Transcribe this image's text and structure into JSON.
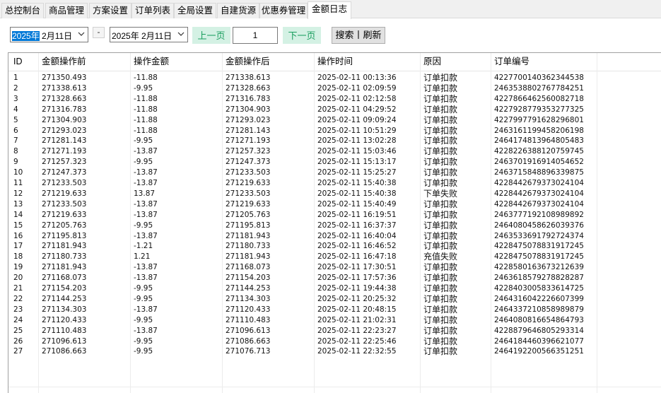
{
  "tabs": [
    {
      "label": "总控制台",
      "active": false
    },
    {
      "label": "商品管理",
      "active": false
    },
    {
      "label": "方案设置",
      "active": false
    },
    {
      "label": "订单列表",
      "active": false
    },
    {
      "label": "全局设置",
      "active": false
    },
    {
      "label": "自建货源",
      "active": false
    },
    {
      "label": "优惠券管理",
      "active": false
    },
    {
      "label": "金额日志",
      "active": true
    }
  ],
  "toolbar": {
    "start_date_year": "2025年",
    "start_date_rest": " 2月11日",
    "end_date": "2025年  2月11日",
    "separator": "-",
    "prev_label": "上一页",
    "page_value": "1",
    "next_label": "下一页",
    "search_label": "搜索丨刷新"
  },
  "colors": {
    "accent_green_bg": "#d4f1e4",
    "accent_green_text": "#1a9e5f",
    "selection_blue": "#0078d7"
  },
  "table": {
    "columns": [
      "ID",
      "金额操作前",
      "操作金额",
      "金额操作后",
      "操作时间",
      "原因",
      "订单编号"
    ],
    "rows": [
      [
        "1",
        "271350.493",
        "-11.88",
        "271338.613",
        "2025-02-11 00:13:36",
        "订单扣款",
        "4227700140362344538"
      ],
      [
        "2",
        "271338.613",
        "-9.95",
        "271328.663",
        "2025-02-11 02:09:59",
        "订单扣款",
        "2463538802767784251"
      ],
      [
        "3",
        "271328.663",
        "-11.88",
        "271316.783",
        "2025-02-11 02:12:58",
        "订单扣款",
        "4227866462560082718"
      ],
      [
        "4",
        "271316.783",
        "-11.88",
        "271304.903",
        "2025-02-11 04:29:52",
        "订单扣款",
        "4227928779353277325"
      ],
      [
        "5",
        "271304.903",
        "-11.88",
        "271293.023",
        "2025-02-11 09:09:24",
        "订单扣款",
        "4227997791628296801"
      ],
      [
        "6",
        "271293.023",
        "-11.88",
        "271281.143",
        "2025-02-11 10:51:29",
        "订单扣款",
        "2463161199458206198"
      ],
      [
        "7",
        "271281.143",
        "-9.95",
        "271271.193",
        "2025-02-11 13:02:28",
        "订单扣款",
        "2464174813964805483"
      ],
      [
        "8",
        "271271.193",
        "-13.87",
        "271257.323",
        "2025-02-11 15:03:46",
        "订单扣款",
        "4228226388120759745"
      ],
      [
        "9",
        "271257.323",
        "-9.95",
        "271247.373",
        "2025-02-11 15:13:17",
        "订单扣款",
        "2463701916914054652"
      ],
      [
        "10",
        "271247.373",
        "-13.87",
        "271233.503",
        "2025-02-11 15:25:27",
        "订单扣款",
        "2463715848896339875"
      ],
      [
        "11",
        "271233.503",
        "-13.87",
        "271219.633",
        "2025-02-11 15:40:38",
        "订单扣款",
        "4228442679373024104"
      ],
      [
        "12",
        "271219.633",
        "13.87",
        "271233.503",
        "2025-02-11 15:40:38",
        "下单失败",
        "4228442679373024104"
      ],
      [
        "13",
        "271233.503",
        "-13.87",
        "271219.633",
        "2025-02-11 15:40:49",
        "订单扣款",
        "4228442679373024104"
      ],
      [
        "14",
        "271219.633",
        "-13.87",
        "271205.763",
        "2025-02-11 16:19:51",
        "订单扣款",
        "2463777192108989892"
      ],
      [
        "15",
        "271205.763",
        "-9.95",
        "271195.813",
        "2025-02-11 16:37:37",
        "订单扣款",
        "2464080458626039376"
      ],
      [
        "16",
        "271195.813",
        "-13.87",
        "271181.943",
        "2025-02-11 16:40:04",
        "订单扣款",
        "2463533691792724374"
      ],
      [
        "17",
        "271181.943",
        "-1.21",
        "271180.733",
        "2025-02-11 16:46:52",
        "订单扣款",
        "4228475078831917245"
      ],
      [
        "18",
        "271180.733",
        "1.21",
        "271181.943",
        "2025-02-11 16:47:18",
        "充值失败",
        "4228475078831917245"
      ],
      [
        "19",
        "271181.943",
        "-13.87",
        "271168.073",
        "2025-02-11 17:30:51",
        "订单扣款",
        "4228580163673212639"
      ],
      [
        "20",
        "271168.073",
        "-13.87",
        "271154.203",
        "2025-02-11 17:57:36",
        "订单扣款",
        "2463618579278828287"
      ],
      [
        "21",
        "271154.203",
        "-9.95",
        "271144.253",
        "2025-02-11 19:44:38",
        "订单扣款",
        "4228403005833614725"
      ],
      [
        "22",
        "271144.253",
        "-9.95",
        "271134.303",
        "2025-02-11 20:25:32",
        "订单扣款",
        "2464316042226607399"
      ],
      [
        "23",
        "271134.303",
        "-13.87",
        "271120.433",
        "2025-02-11 20:48:15",
        "订单扣款",
        "2464337210858989879"
      ],
      [
        "24",
        "271120.433",
        "-9.95",
        "271110.483",
        "2025-02-11 21:02:31",
        "订单扣款",
        "2464080816654864793"
      ],
      [
        "25",
        "271110.483",
        "-13.87",
        "271096.613",
        "2025-02-11 22:23:27",
        "订单扣款",
        "4228879646805293314"
      ],
      [
        "26",
        "271096.613",
        "-9.95",
        "271086.663",
        "2025-02-11 22:25:46",
        "订单扣款",
        "2464184460396621077"
      ],
      [
        "27",
        "271086.663",
        "-9.95",
        "271076.713",
        "2025-02-11 22:32:55",
        "订单扣款",
        "2464192200566351251"
      ]
    ]
  }
}
